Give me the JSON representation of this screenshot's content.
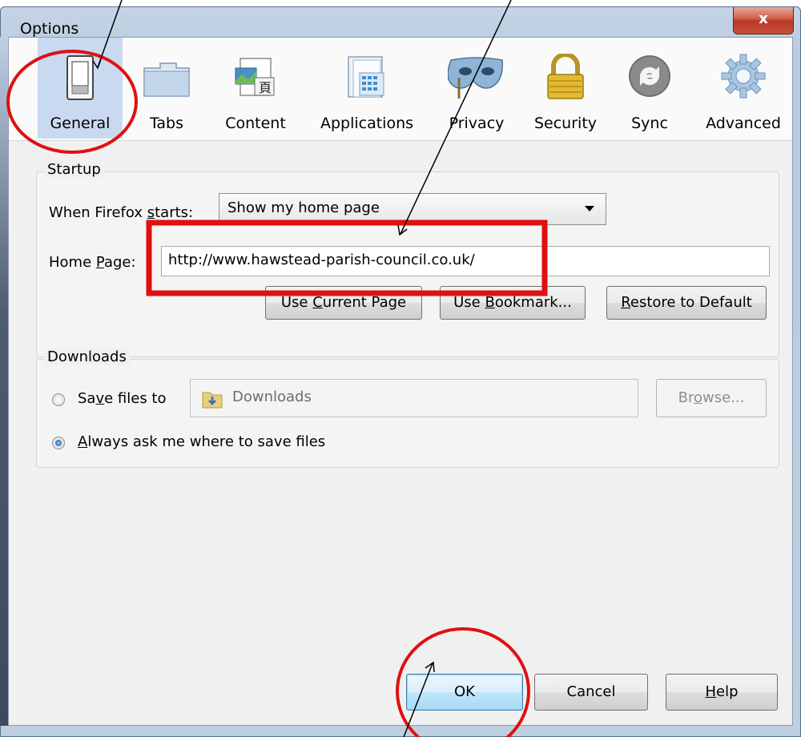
{
  "window": {
    "title": "Options",
    "close_label": "x"
  },
  "toolbar": {
    "tabs": [
      {
        "label": "General",
        "icon": "switch-icon",
        "selected": true
      },
      {
        "label": "Tabs",
        "icon": "folder-tab-icon"
      },
      {
        "label": "Content",
        "icon": "content-page-icon"
      },
      {
        "label": "Applications",
        "icon": "applications-window-icon"
      },
      {
        "label": "Privacy",
        "icon": "mask-icon"
      },
      {
        "label": "Security",
        "icon": "padlock-icon"
      },
      {
        "label": "Sync",
        "icon": "sync-icon"
      },
      {
        "label": "Advanced",
        "icon": "gear-icon"
      }
    ]
  },
  "startup": {
    "group_title": "Startup",
    "when_starts_label_pre": "When Firefox ",
    "when_starts_label_key": "s",
    "when_starts_label_post": "tarts:",
    "when_starts_value": "Show my home page",
    "home_page_label_pre": "Home ",
    "home_page_label_key": "P",
    "home_page_label_post": "age:",
    "home_page_value": "http://www.hawstead-parish-council.co.uk/",
    "buttons": {
      "use_current_pre": "Use ",
      "use_current_key": "C",
      "use_current_post": "urrent Page",
      "use_bookmark_pre": "Use ",
      "use_bookmark_key": "B",
      "use_bookmark_post": "ookmark...",
      "restore_pre": "",
      "restore_key": "R",
      "restore_post": "estore to Default"
    }
  },
  "downloads": {
    "group_title": "Downloads",
    "save_files_pre": "Sa",
    "save_files_key": "v",
    "save_files_post": "e files to",
    "folder_value": "Downloads",
    "browse_pre": "Br",
    "browse_key": "o",
    "browse_post": "wse...",
    "always_ask_pre": "",
    "always_ask_key": "A",
    "always_ask_post": "lways ask me where to save files",
    "always_ask_selected": true
  },
  "footer": {
    "ok_label": "OK",
    "cancel_label": "Cancel",
    "help_pre": "",
    "help_key": "H",
    "help_post": "elp"
  },
  "colors": {
    "annotation_red": "#e01010",
    "selected_tab_bg": "#c9daf0"
  }
}
